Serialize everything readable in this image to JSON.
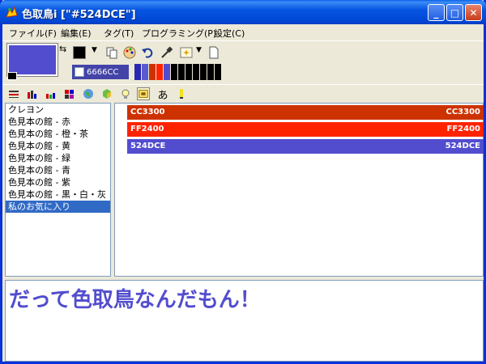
{
  "window": {
    "title": "色取鳥i [\"#524DCE\"]",
    "minimize_label": "_",
    "maximize_label": "□",
    "close_label": "✕"
  },
  "menu": [
    {
      "label": "ファイル(F)"
    },
    {
      "label": "編集(E)"
    },
    {
      "label": "タグ(T)"
    },
    {
      "label": "プログラミング(P)"
    },
    {
      "label": "設定(C)"
    }
  ],
  "current_color": {
    "hex": "6666CC",
    "main": "#524dce",
    "secondary": "#000000"
  },
  "palette": [
    "#2828b0",
    "#5a5ad0",
    "#cc3300",
    "#ff2400",
    "#524dce",
    "#000000",
    "#000000",
    "#000000",
    "#000000",
    "#000000",
    "#000000",
    "#000000"
  ],
  "toolbar_icons": [
    "copy-icon",
    "palette-icon",
    "undo-icon",
    "eyedropper-icon",
    "picker-icon",
    "new-icon"
  ],
  "toolbar2_icons": [
    "list-view-icon",
    "bar-view-icon",
    "small-bar-icon",
    "grid-icon",
    "globe-icon",
    "cube-icon",
    "bulb-icon",
    "tag-icon",
    "kana-icon",
    "marker-icon"
  ],
  "toolbar2_kana": "あ",
  "categories": [
    {
      "label": "クレヨン",
      "selected": false
    },
    {
      "label": "色見本の館 - 赤",
      "selected": false
    },
    {
      "label": "色見本の館 - 橙・茶",
      "selected": false
    },
    {
      "label": "色見本の館 - 黄",
      "selected": false
    },
    {
      "label": "色見本の館 - 緑",
      "selected": false
    },
    {
      "label": "色見本の館 - 青",
      "selected": false
    },
    {
      "label": "色見本の館 - 紫",
      "selected": false
    },
    {
      "label": "色見本の館 - 黒・白・灰",
      "selected": false
    },
    {
      "label": "私のお気に入り",
      "selected": true
    }
  ],
  "favorites": [
    {
      "left": "CC3300",
      "right": "CC3300",
      "color": "#cc3300"
    },
    {
      "left": "FF2400",
      "right": "FF2400",
      "color": "#ff2400"
    },
    {
      "left": "524DCE",
      "right": "524DCE",
      "color": "#524dce"
    }
  ],
  "sample": {
    "text": "だって色取鳥なんだもん！",
    "color": "#524dce"
  }
}
